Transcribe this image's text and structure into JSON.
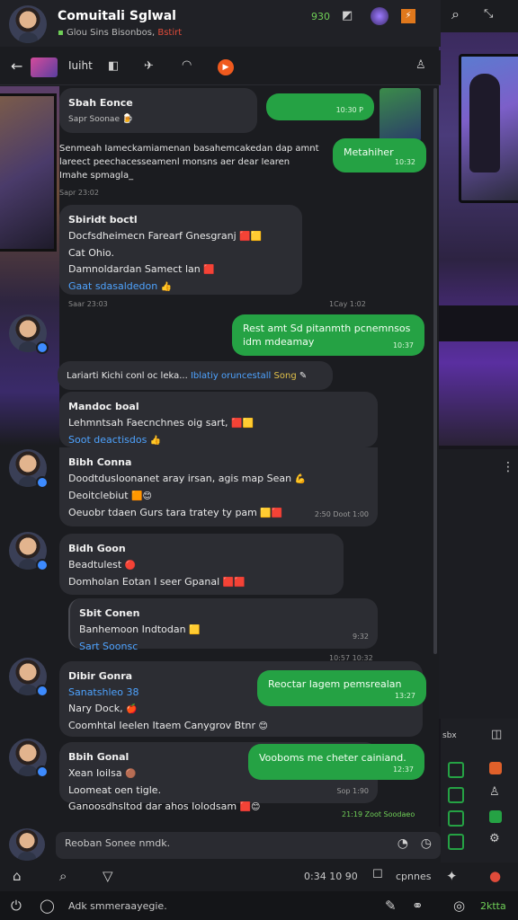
{
  "header": {
    "title": "Comuitali Sglwal",
    "subtitle_a": "Glou Sins Bisonbos,",
    "subtitle_b": "Bstirt",
    "status_count": "930",
    "badge": "⚡"
  },
  "toolbar": {
    "tab_label": "Iuiht",
    "icons": [
      "back-arrow",
      "gallery",
      "bookmark",
      "pin",
      "bell",
      "record",
      "person"
    ]
  },
  "messages": [
    {
      "type": "in",
      "sender": "Sbah Eonce",
      "text": "Sapr Soonae",
      "time": ""
    },
    {
      "type": "out",
      "text": "",
      "time": "10:30 P"
    },
    {
      "type": "out",
      "text": "Metahiher",
      "time": "10:32"
    },
    {
      "type": "in",
      "text": "Senmeah Iameckamiamenan basahemcakedan dap amnt lareect peechacesseamenl monsns aer dear Iearen Imahe spmagla_",
      "time": "Sapr 23:02"
    },
    {
      "type": "in",
      "sender": "Sbiridt boctl",
      "lines": [
        "Docfsdheimecn Farearf Gnesgranj",
        "Cat Ohio.",
        "Damnoldardan Samect lan"
      ],
      "link": "Gaat sdasaldedon",
      "time": "1Cay 1:02"
    },
    {
      "type": "meta",
      "text": "Saar 23:03"
    },
    {
      "type": "out",
      "text": "Rest amt Sd pitanmth pcnemnsos idm mdeamay",
      "time": "10:37"
    },
    {
      "type": "in",
      "text": "Lariarti Kichi conl oc leka...",
      "link": "Iblatiy oruncestall",
      "extra": "Song",
      "time": ""
    },
    {
      "type": "in",
      "sender": "Mandoc boal",
      "lines": [
        "Lehmntsah Faecnchnes oig sart,"
      ],
      "link": "Soot deactisdos",
      "time": ""
    },
    {
      "type": "in",
      "sender": "Bibh Conna",
      "lines": [
        "Doodtdusloonanet aray irsan, agis map Sean",
        "Deoitclebiut",
        "Oeuobr tdaen Gurs tara tratey ty pam"
      ],
      "time": "2:50 Doot 1:00"
    },
    {
      "type": "in",
      "sender": "Bidh Goon",
      "lines": [
        "Beadtulest",
        "Domholan Eotan I seer Gpanal"
      ],
      "time": ""
    },
    {
      "type": "in",
      "sender": "Sbit Conen",
      "lines": [
        "Banhemoon Indtodan"
      ],
      "link": "Sart Soonsc",
      "time": "9:32"
    },
    {
      "type": "meta",
      "text": "10:57 10:32"
    },
    {
      "type": "in",
      "sender": "Dibir Gonra",
      "lines": [
        "Sanatshleo 38",
        "Nary Dock,",
        "Coomhtal Ieelen Itaem Canygrov Btnr"
      ],
      "time": ""
    },
    {
      "type": "out",
      "text": "Reoctar Iagem pemsrealan",
      "time": "13:27"
    },
    {
      "type": "in",
      "sender": "Bbih Gonal",
      "lines": [
        "Xean Ioilsa",
        "Loomeat oen tigle.",
        "Ganoosdhsltod dar ahos Iolodsam"
      ],
      "time": "Sop 1:90"
    },
    {
      "type": "out",
      "text": "Vooboms me cheter cainiand.",
      "time": "12:37"
    },
    {
      "type": "meta",
      "text": "21:19 Zoot Soodaeo"
    }
  ],
  "composer": {
    "placeholder": "Reoban Sonee nmdk."
  },
  "bottom_bar": {
    "status_text": "0:34 10 90",
    "right_text": "cpnnes"
  },
  "footer": {
    "text": "Adk smmeraayegie.",
    "right_text": "2ktta"
  },
  "colors": {
    "accent_green": "#25a244",
    "link_blue": "#4ea3ff",
    "bubble_in": "#2c2d33"
  }
}
